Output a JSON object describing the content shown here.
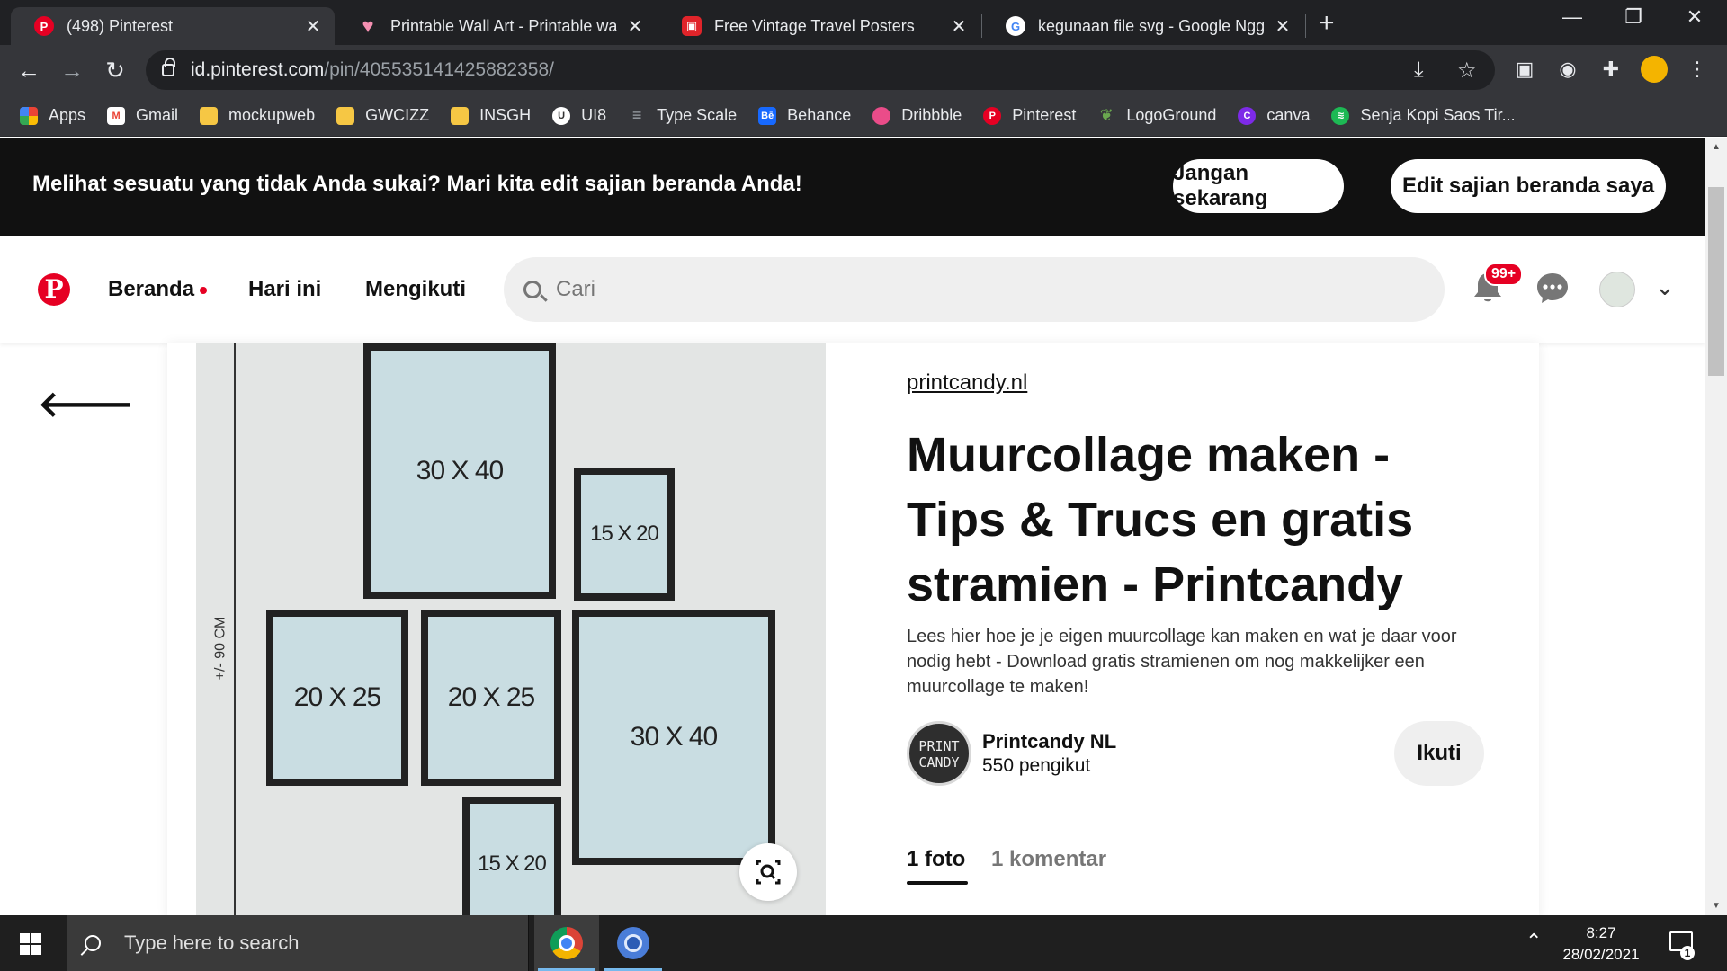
{
  "browser": {
    "tabs": [
      {
        "title": "(498) Pinterest",
        "icon": "pinterest-icon",
        "active": true
      },
      {
        "title": "Printable Wall Art - Printable wall",
        "icon": "heart-icon",
        "active": false
      },
      {
        "title": "Free Vintage Travel Posters",
        "icon": "poster-site-icon",
        "active": false
      },
      {
        "title": "kegunaan file svg - Google Nggo",
        "icon": "google-icon",
        "active": false
      }
    ],
    "new_tab_glyph": "+",
    "url_host": "id.pinterest.com",
    "url_path": "/pin/405535141425882358/",
    "bookmarks": [
      {
        "label": "Apps",
        "icon": "apps-grid-icon",
        "color": "#ea4335"
      },
      {
        "label": "Gmail",
        "icon": "gmail-icon",
        "color": "#ea4335"
      },
      {
        "label": "mockupweb",
        "icon": "folder-icon",
        "color": "#f6c744"
      },
      {
        "label": "GWCIZZ",
        "icon": "folder-icon",
        "color": "#f6c744"
      },
      {
        "label": "INSGH",
        "icon": "folder-icon",
        "color": "#f6c744"
      },
      {
        "label": "UI8",
        "icon": "ui8-icon",
        "color": "#ffffff"
      },
      {
        "label": "Type Scale",
        "icon": "type-scale-icon",
        "color": "#9aa0a6"
      },
      {
        "label": "Behance",
        "icon": "behance-icon",
        "color": "#1769ff"
      },
      {
        "label": "Dribbble",
        "icon": "dribbble-icon",
        "color": "#ea4c89"
      },
      {
        "label": "Pinterest",
        "icon": "pinterest-icon",
        "color": "#e60023"
      },
      {
        "label": "LogoGround",
        "icon": "logoground-icon",
        "color": "#6aa84f"
      },
      {
        "label": "canva",
        "icon": "canva-icon",
        "color": "#7d2ae8"
      },
      {
        "label": "Senja Kopi Saos Tir...",
        "icon": "spotify-icon",
        "color": "#1db954"
      }
    ]
  },
  "banner": {
    "text": "Melihat sesuatu yang tidak Anda sukai? Mari kita edit sajian beranda Anda!",
    "not_now": "Jangan sekarang",
    "edit": "Edit sajian beranda saya"
  },
  "header": {
    "nav": [
      "Beranda",
      "Hari ini",
      "Mengikuti"
    ],
    "search_placeholder": "Cari",
    "notification_count": "99+",
    "brand_color": "#e60023"
  },
  "pin": {
    "source": "printcandy.nl",
    "title": "Muurcollage maken - Tips & Trucs en gratis stramien - Printcandy",
    "description": "Lees hier hoe je je eigen muurcollage kan maken en wat je daar voor nodig hebt - Download gratis stramienen om nog makkelijker een muurcollage te maken!",
    "creator_name": "Printcandy NL",
    "creator_followers": "550 pengikut",
    "creator_avatar_text": "PRINT CANDY",
    "follow_label": "Ikuti",
    "tabs": [
      "1 foto",
      "1 komentar"
    ],
    "image": {
      "measure_label": "+/- 90 CM",
      "frames": [
        "30 X 40",
        "15 X 20",
        "20 X 25",
        "20 X 25",
        "30 X 40",
        "15 X 20"
      ]
    }
  },
  "taskbar": {
    "search_placeholder": "Type here to search",
    "time": "8:27",
    "date": "28/02/2021",
    "notification_count": "1"
  }
}
